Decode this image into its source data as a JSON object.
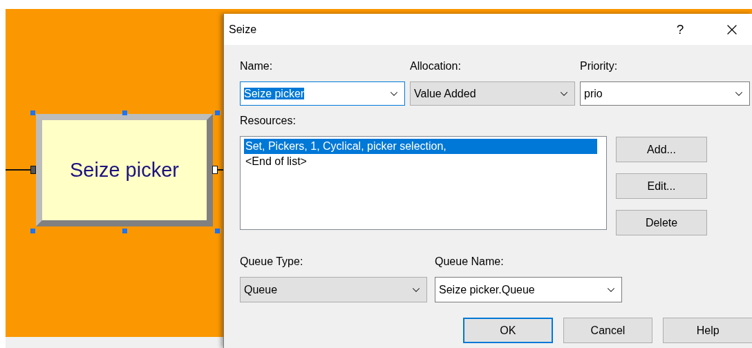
{
  "canvas": {
    "module": {
      "label": "Seize picker",
      "selected": true
    }
  },
  "dialog": {
    "title": "Seize",
    "help_button": "?",
    "top_fields": [
      {
        "label": "Name:",
        "value": "Seize picker",
        "kind": "combo",
        "focused": true,
        "text_selected": true
      },
      {
        "label": "Allocation:",
        "value": "Value Added",
        "kind": "dropdown",
        "focused": false,
        "text_selected": false
      },
      {
        "label": "Priority:",
        "value": "prio",
        "kind": "combo",
        "focused": false,
        "text_selected": false
      }
    ],
    "resources": {
      "label": "Resources:",
      "items": [
        {
          "text": "Set, Pickers, 1, Cyclical, picker selection,",
          "selected": true
        },
        {
          "text": "<End of list>",
          "selected": false
        }
      ],
      "buttons": [
        "Add...",
        "Edit...",
        "Delete"
      ]
    },
    "queue_fields": [
      {
        "label": "Queue Type:",
        "value": "Queue",
        "kind": "dropdown",
        "focused": false,
        "text_selected": false
      },
      {
        "label": "Queue Name:",
        "value": "Seize picker.Queue",
        "kind": "combo",
        "focused": false,
        "text_selected": false
      }
    ],
    "footer_buttons": [
      {
        "label": "OK",
        "default": true
      },
      {
        "label": "Cancel",
        "default": false
      },
      {
        "label": "Help",
        "default": false
      }
    ]
  }
}
